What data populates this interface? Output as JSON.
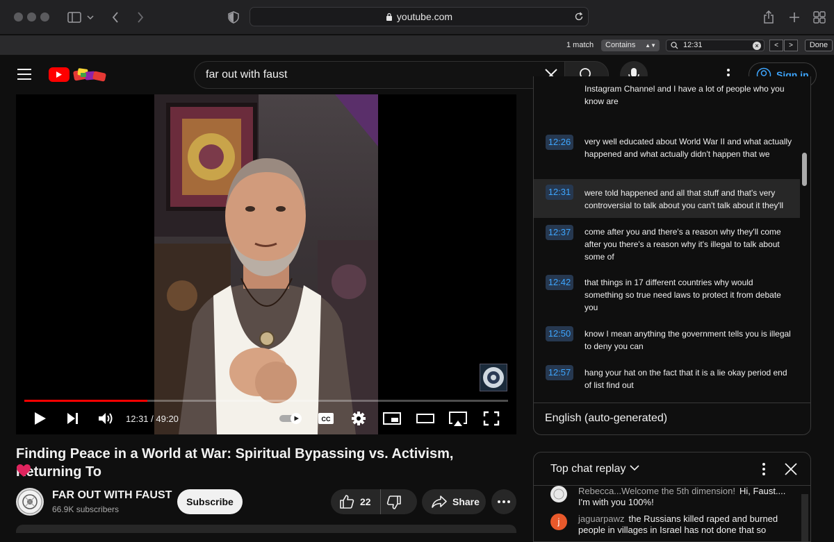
{
  "browser": {
    "url": "youtube.com",
    "find": {
      "match_count": "1 match",
      "mode": "Contains",
      "query": "12:31",
      "done_label": "Done"
    }
  },
  "youtube": {
    "search_query": "far out with faust",
    "sign_in_label": "Sign in",
    "colors": {
      "brand_red": "#ff0000",
      "link_blue": "#3ea6ff"
    }
  },
  "player": {
    "current_time": "12:31",
    "duration": "49:20",
    "time_readout": "12:31 / 49:20",
    "progress_fraction": 0.254
  },
  "transcript": {
    "segments": [
      {
        "time": "",
        "text": "Instagram Channel and I have a lot of people who you know are"
      },
      {
        "time": "12:26",
        "text": "very well educated about World War II and what actually happened and what actually didn't happen that we"
      },
      {
        "time": "12:31",
        "text": "were told happened and all that stuff and that's very controversial to talk about you can't talk about it they'll"
      },
      {
        "time": "12:37",
        "text": "come after you and there's a reason why they'll come after you there's a reason why it's illegal to talk about some of"
      },
      {
        "time": "12:42",
        "text": "that things in 17 different countries why would something so true need laws to protect it from debate you"
      },
      {
        "time": "12:50",
        "text": "know I mean anything the government tells you is illegal to deny you can"
      },
      {
        "time": "12:57",
        "text": "hang your hat on the fact that it is a lie okay period end of list find out"
      }
    ],
    "language": "English (auto-generated)"
  },
  "video": {
    "title": "Finding Peace in a World at War: Spiritual Bypassing vs. Activism, Returning To",
    "channel_name": "FAR OUT WITH FAUST",
    "subscribers": "66.9K subscribers",
    "subscribe_label": "Subscribe",
    "likes": "22",
    "share_label": "Share"
  },
  "chat": {
    "title": "Top chat replay",
    "messages": [
      {
        "author": "Rebecca...Welcome the 5th dimension!",
        "text": "Hi, Faust.... I'm with you 100%!",
        "avatar_color": "#e8e8e8"
      },
      {
        "author": "jaguarpawz",
        "text": "the Russians killed raped and burned people in villages in Israel has not done that so",
        "avatar_color": "#e8592b",
        "initial": "j"
      }
    ]
  }
}
